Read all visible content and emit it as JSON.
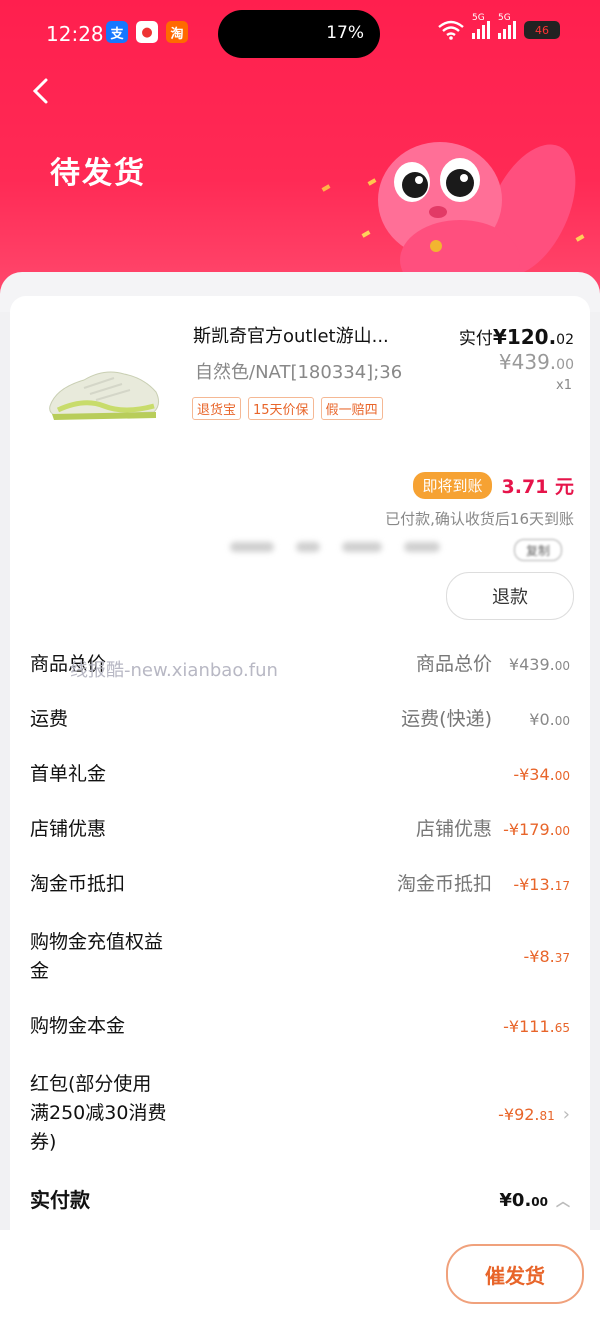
{
  "status_bar": {
    "time": "12:28",
    "app_icons": [
      "支",
      "淘"
    ],
    "battery_percent": "17%",
    "network_labels": [
      "5G",
      "5G"
    ],
    "battery_level": "46"
  },
  "header": {
    "title": "待发货"
  },
  "product": {
    "title": "斯凯奇官方outlet游山...",
    "sku": "自然色/NAT[180334];36",
    "tags": [
      "退货宝",
      "15天价保",
      "假一赔四"
    ],
    "paid_label": "实付",
    "paid_main": "¥120.",
    "paid_cents": "02",
    "original_main": "¥439.",
    "original_cents": "00",
    "quantity": "x1"
  },
  "settlement": {
    "badge": "即将到账",
    "amount": "3.71 元",
    "note": "已付款,确认收货后16天到账",
    "copy_label": "复制"
  },
  "refund_button": "退款",
  "fees": [
    {
      "label": "商品总价",
      "sub": "商品总价",
      "value": "¥439.",
      "cents": "00",
      "tone": "grey"
    },
    {
      "label": "运费",
      "sub": "运费(快递)",
      "value": "¥0.",
      "cents": "00",
      "tone": "grey"
    },
    {
      "label": "首单礼金",
      "sub": "",
      "value": "-¥34.",
      "cents": "00",
      "tone": "orange"
    },
    {
      "label": "店铺优惠",
      "sub": "店铺优惠",
      "value": "-¥179.",
      "cents": "00",
      "tone": "orange"
    },
    {
      "label": "淘金币抵扣",
      "sub": "淘金币抵扣",
      "value": "-¥13.",
      "cents": "17",
      "tone": "orange"
    },
    {
      "label": "购物金充值权益金",
      "sub": "",
      "value": "-¥8.",
      "cents": "37",
      "tone": "orange"
    },
    {
      "label": "购物金本金",
      "sub": "",
      "value": "-¥111.",
      "cents": "65",
      "tone": "orange"
    },
    {
      "label": "红包(部分使用满250减30消费券)",
      "sub": "",
      "value": "-¥92.",
      "cents": "81",
      "tone": "orange"
    }
  ],
  "total": {
    "label": "实付款",
    "value": "¥0.",
    "cents": "00"
  },
  "watermark": "线报酷-new.xianbao.fun",
  "bottom": {
    "urge_button": "催发货"
  }
}
